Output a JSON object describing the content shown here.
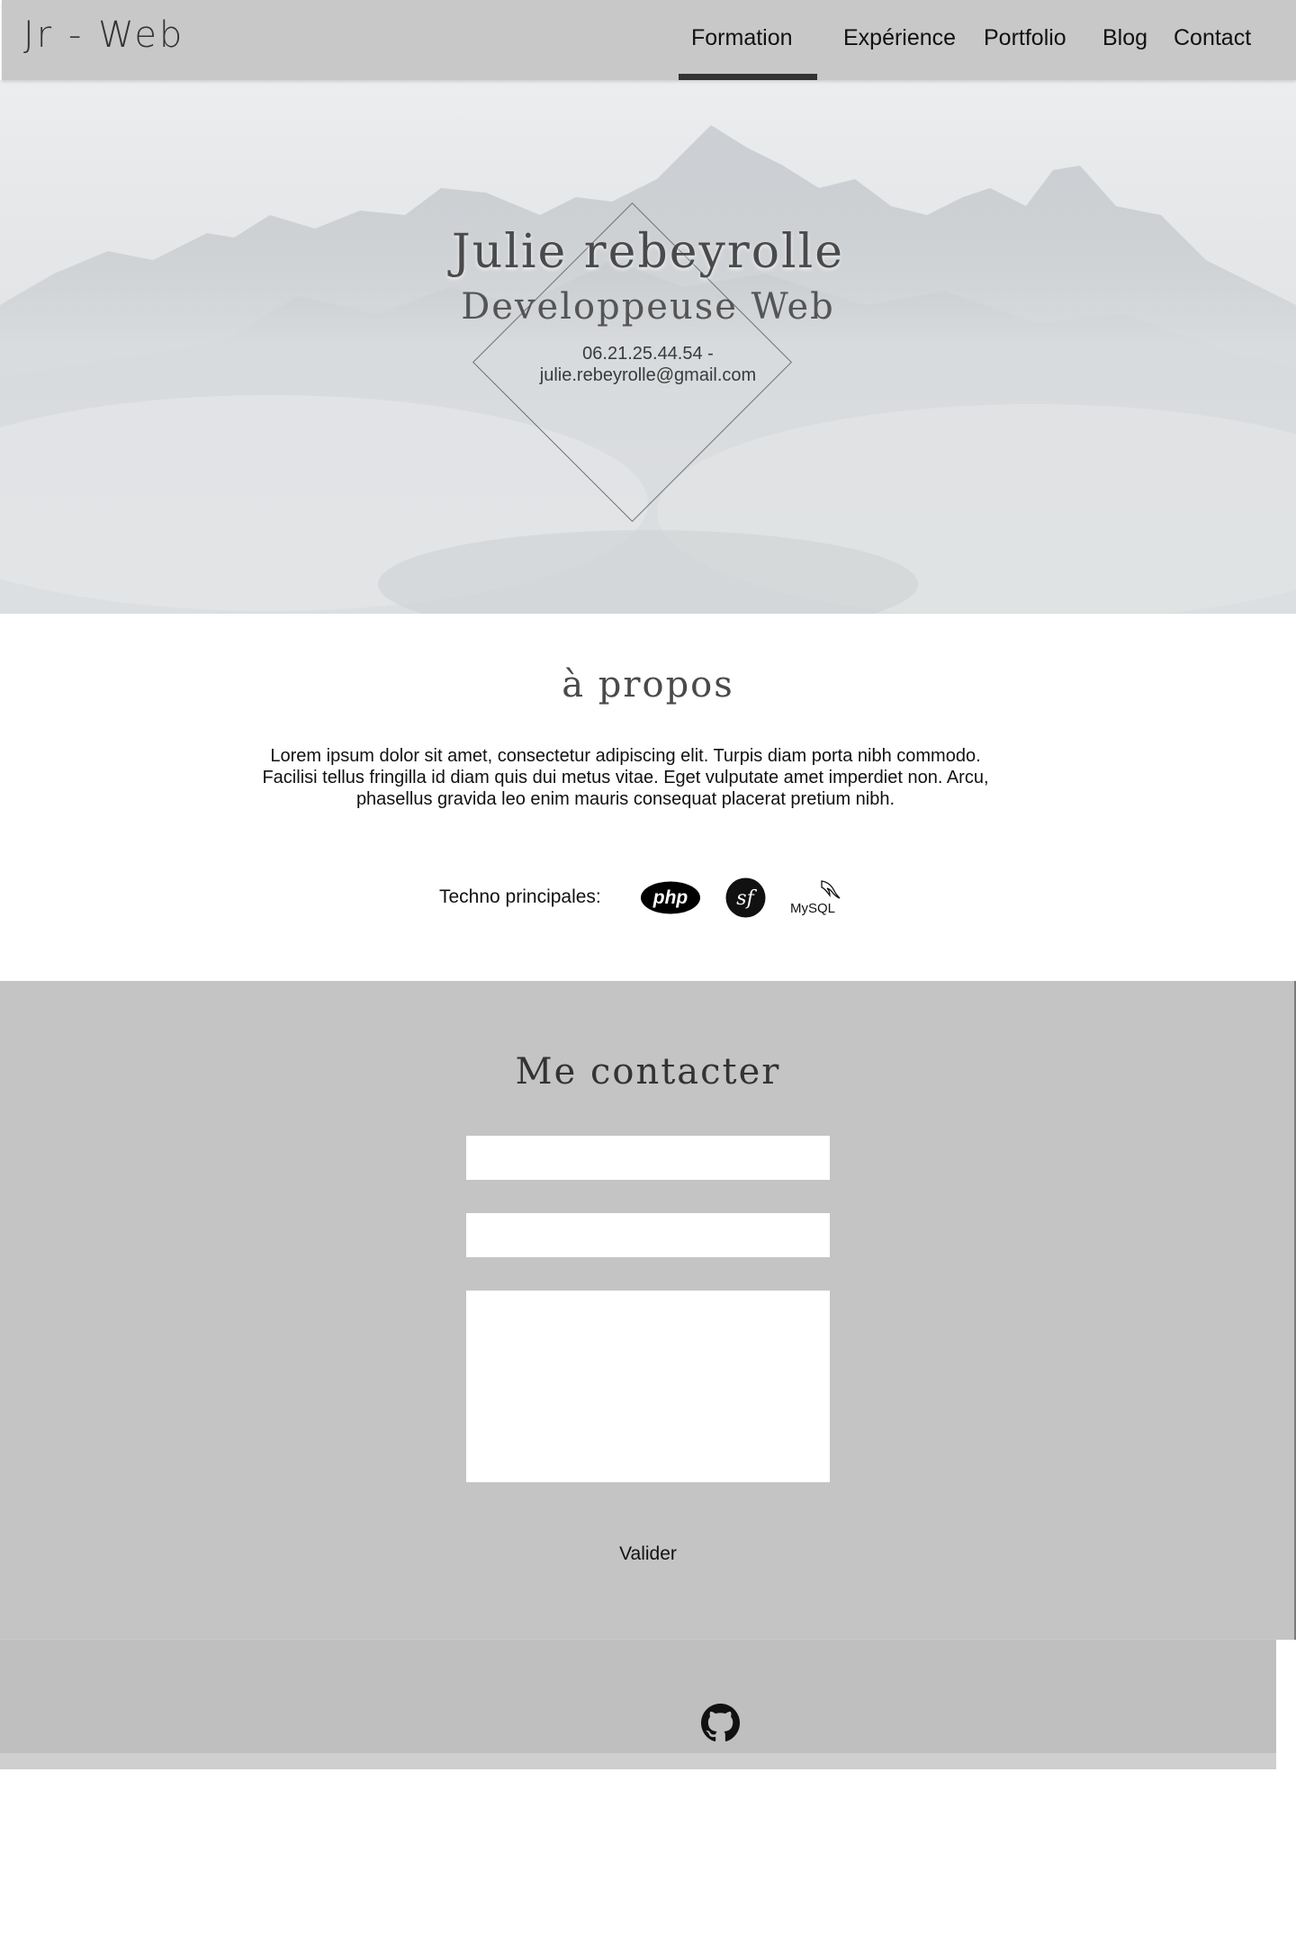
{
  "header": {
    "brand": "Jr - Web",
    "nav": [
      "Formation",
      "Expérience",
      "Portfolio",
      "Blog",
      "Contact"
    ],
    "active_nav": "Formation"
  },
  "hero": {
    "name": "Julie rebeyrolle",
    "role": "Developpeuse Web",
    "phone": "06.21.25.44.54 -",
    "email": "julie.rebeyrolle@gmail.com"
  },
  "about": {
    "title": "à propos",
    "text": "Lorem ipsum dolor sit amet, consectetur adipiscing elit. Turpis diam porta nibh commodo. Facilisi tellus fringilla id diam quis dui metus vitae. Eget vulputate amet imperdiet non. Arcu, phasellus gravida leo enim mauris consequat placerat pretium nibh.",
    "techno_label": "Techno principales:",
    "technos": [
      {
        "name": "php-logo",
        "text": "php"
      },
      {
        "name": "symfony-logo",
        "text": "sf"
      },
      {
        "name": "mysql-logo",
        "text": "MySQL"
      }
    ]
  },
  "contact": {
    "title": "Me contacter",
    "submit_label": "Valider"
  },
  "footer": {
    "icon": "github-icon"
  }
}
